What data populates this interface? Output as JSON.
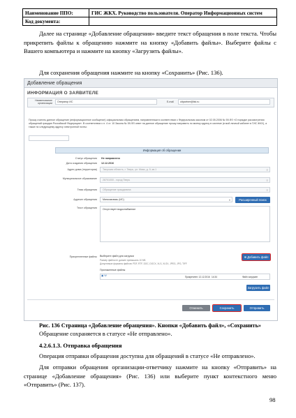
{
  "header": {
    "row1_left": "Наименование ППО:",
    "row1_right": "ГИС ЖКХ. Руководство пользователя. Оператор Информационных систем",
    "row2_left": "Код документа:",
    "row2_right": ""
  },
  "para1": "Далее на странице «Добавление обращения» введите текст обращения в поле текста. Чтобы прикрепить файлы к обращению нажмите на кнопку «Добавить файлы». Выберите файлы с Вашего компьютера и нажмите на кнопку «Загрузить файлы».",
  "para2": "Для сохранения обращения нажмите на кнопку «Сохранить» (Рис. 136).",
  "screenshot": {
    "window_title": "Добавление обращения",
    "section_title": "ИНФОРМАЦИЯ О ЗАЯВИТЕЛЕ",
    "org_label": "Наименование организации",
    "org_value": "Оператор ИС",
    "email_label": "E-mail",
    "email_value": "oitpartner@list.ru",
    "consent_text": "Прошу считать данное обращение (информационное сообщение) официальным обращением, направленным в соответствии с Федеральным законом от 02.05.2006 № 59-ФЗ «О порядке рассмотрения обращений граждан Российской Федерации». В соответствии с п. 4 ст. 10 Закона № 59-ФЗ ответ на данное обращение прошу направить по моему адресу в системе (в мой личный кабинет в ГИС ЖКХ), а также по следующему адресу электронной почты:",
    "info_bar": "Информация об обращении",
    "status_label": "Статус обращения",
    "status_value": "Не направлено",
    "date_label": "Дата создания обращения",
    "date_value": "12.12.2016",
    "address_label": "Адрес дома (территории)",
    "address_value": "Тверская область, г. Тверь, ул. Маяк, д. 5, кв.1",
    "municipal_label": "Муниципальное образование",
    "municipal_value": "28701000 - город Тверь",
    "topic_label": "Тема обращения",
    "topic_value": "Обращение гражданина",
    "addressee_label": "Адресат обращения",
    "addressee_value": "Минкомсвязь (ИС)",
    "extended_search": "Расширенный поиск",
    "text_label": "Текст обращения",
    "text_value": "Отсутствует водоснабжение",
    "files_label": "Прикрепленные файлы",
    "files_hint1": "Выберите файл для загрузки",
    "files_hint2": "Размер файла не должен превышать 10 МБ",
    "files_hint3": "Допустимые форматы файлов: PDF, RTF, DOC, DOCX, XLS, XLSX, JPEG, JPG, TIFF",
    "attached_label": "Приложенные файлы",
    "file_date": "Прикреплен: 12.12.2016",
    "file_time": "14:34",
    "file_status": "Файл загружен",
    "add_file_button": "Добавить файл",
    "upload_button": "Загрузить файл",
    "cancel_button": "Отменить",
    "save_button": "Сохранить",
    "send_button": "Отправить"
  },
  "caption": "Рис. 136 Страница «Добавление обращения». Кнопки «Добавить файл», «Сохранить»",
  "after_caption": "Обращение сохраняется в статусе «Не отправлено».",
  "heading": "4.2.6.1.3. Отправка обращения",
  "para3": "Операция отправки обращения доступна для обращений в статусе «Не отправлено».",
  "para4": "Для отправки обращения организации-ответчику нажмите на кнопку «Отправить» на странице «Добавление обращения» (Рис. 136) или выберите пункт контекстного меню «Отправить» (Рис. 137).",
  "page_number": "98"
}
